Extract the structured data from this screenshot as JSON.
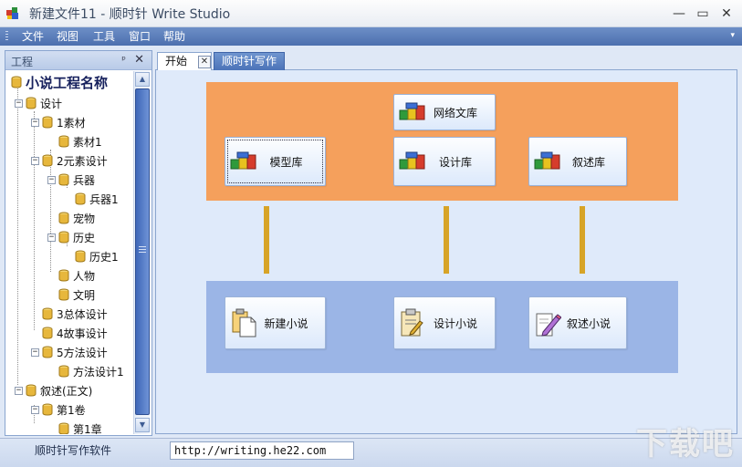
{
  "window": {
    "title": "新建文件11 - 顺时针 Write Studio",
    "controls": {
      "minimize": "—",
      "maximize": "▭",
      "close": "✕"
    }
  },
  "menu": {
    "items": [
      "文件",
      "视图",
      "工具",
      "窗口",
      "帮助"
    ],
    "overflow": "▾"
  },
  "dock": {
    "title": "工程",
    "pin": "ᵖ",
    "close": "✕"
  },
  "tree": {
    "root": "小说工程名称",
    "nodes": [
      "设计",
      "1素材",
      "素材1",
      "2元素设计",
      "兵器",
      "兵器1",
      "宠物",
      "历史",
      "历史1",
      "人物",
      "文明",
      "3总体设计",
      "4故事设计",
      "5方法设计",
      "方法设计1",
      "叙述(正文)",
      "第1卷",
      "第1章"
    ],
    "expand_glyph": "−",
    "scroll_up": "▲",
    "scroll_down": "▼"
  },
  "tabs": [
    {
      "label": "开始",
      "close": "✕"
    },
    {
      "label": "顺时针写作"
    }
  ],
  "start_page": {
    "design_tiles": [
      "网络文库",
      "模型库",
      "设计库",
      "叙述库"
    ],
    "writing_tiles": [
      "新建小说",
      "设计小说",
      "叙述小说"
    ]
  },
  "status": {
    "left_text": "顺时针写作软件",
    "url": "http://writing.he22.com"
  },
  "watermark": {
    "text": "下载吧"
  },
  "colors": {
    "menu_bar": "#4c6fae",
    "orange_panel": "#f5a05c",
    "blue_panel": "#9bb5e6",
    "connector": "#d7a427",
    "tree_root": "#17215d"
  }
}
